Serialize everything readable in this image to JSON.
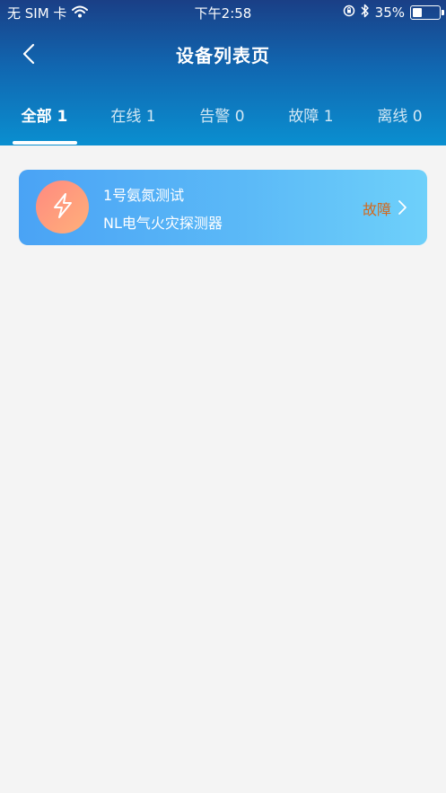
{
  "status_bar": {
    "carrier": "无 SIM 卡",
    "time": "下午2:58",
    "battery_percent": "35%",
    "battery_level": 0.35,
    "icons": [
      "wifi-icon",
      "orientation-lock-icon",
      "bluetooth-icon",
      "battery-icon"
    ]
  },
  "nav": {
    "title": "设备列表页",
    "back_icon": "chevron-left-icon"
  },
  "tabs": [
    {
      "label": "全部 1",
      "active": true
    },
    {
      "label": "在线 1",
      "active": false
    },
    {
      "label": "告警 0",
      "active": false
    },
    {
      "label": "故障 1",
      "active": false
    },
    {
      "label": "离线 0",
      "active": false
    }
  ],
  "devices": [
    {
      "name": "1号氨氮测试",
      "type": "NL电气火灾探测器",
      "status": "故障",
      "icon": "lightning-icon"
    }
  ],
  "colors": {
    "status_fault": "#d2691e",
    "card_gradient_start": "#4aa3f5",
    "card_gradient_end": "#6ed0fa",
    "header_top": "#1a3f86",
    "header_bottom": "#0a8fd0"
  }
}
